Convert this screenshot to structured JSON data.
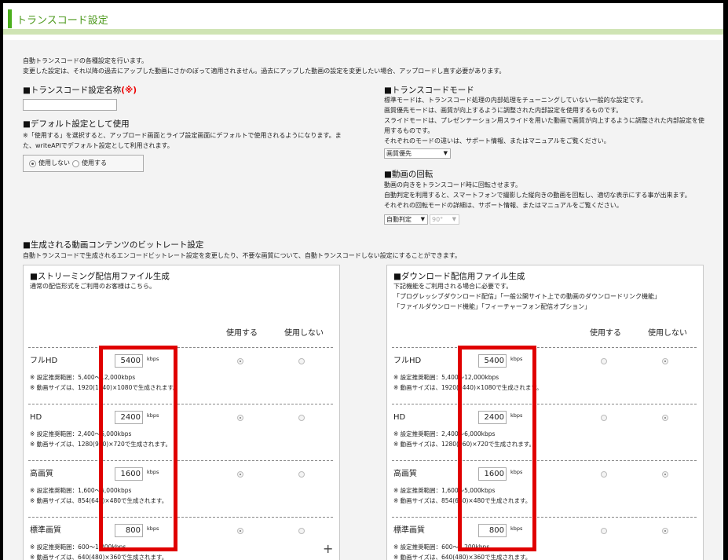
{
  "header": {
    "title": "トランスコード設定"
  },
  "intro": {
    "line1": "自動トランスコードの各種設定を行います。",
    "line2": "変更した設定は、それ以降の過去にアップした動画にさかのぼって適用されません。過去にアップした動画の設定を変更したい場合、アップロードし直す必要があります。"
  },
  "name_setting": {
    "label": "■トランスコード設定名称",
    "required": "(※)",
    "value": ""
  },
  "default_setting": {
    "label": "■デフォルト設定として使用",
    "desc1": "※「使用する」を選択すると、アップロード画面とライブ設定画面にデフォルトで使用されるようになります。ま",
    "desc2": "た、writeAPIでデフォルト設定として利用されます。",
    "opt_no": "使用しない",
    "opt_yes": "使用する",
    "selected": "no"
  },
  "mode": {
    "label": "■トランスコードモード",
    "desc1": "標準モードは、トランスコード処理の内部処理をチューニングしていない一般的な設定です。",
    "desc2": "画質優先モードは、画質が向上するように調整された内部設定を使用するものです。",
    "desc3": "スライドモードは、プレゼンテーション用スライドを用いた動画で画質が向上するように調整された内部設定を使",
    "desc4": "用するものです。",
    "desc5": "それぞれのモードの違いは、サポート情報、またはマニュアルをご覧ください。",
    "selected": "画質優先"
  },
  "rotation": {
    "label": "■動画の回転",
    "desc1": "動画の向きをトランスコード時に回転させます。",
    "desc2": "自動判定を利用すると、スマートフォンで撮影した縦向きの動画を回転し、適切な表示にする事が出来ます。",
    "desc3": "それぞれの回転モードの詳細は、サポート情報、またはマニュアルをご覧ください。",
    "mode_selected": "自動判定",
    "angle_selected": "90°"
  },
  "bitrate": {
    "label": "■生成される動画コンテンツのビットレート設定",
    "desc": "自動トランスコードで生成されるエンコードビットレート設定を変更したり、不要な画質について、自動トランスコードしない設定にすることができます。"
  },
  "col_use": "使用する",
  "col_nouse": "使用しない",
  "kbps": "kbps",
  "streaming": {
    "title": "■ストリーミング配信用ファイル生成",
    "desc": "通常の配信形式をご利用のお客様はこちら。",
    "rows": [
      {
        "name": "フルHD",
        "rate": "5400",
        "note1": "※ 設定推奨範囲：5,400～12,000kbps",
        "note2": "※ 動画サイズは、1920(1440)×1080で生成されます。",
        "use": true
      },
      {
        "name": "HD",
        "rate": "2400",
        "note1": "※ 設定推奨範囲：2,400～6,000kbps",
        "note2": "※ 動画サイズは、1280(960)×720で生成されます。",
        "use": true
      },
      {
        "name": "高画質",
        "rate": "1600",
        "note1": "※ 設定推奨範囲：1,600～5,000kbps",
        "note2": "※ 動画サイズは、854(640)×480で生成されます。",
        "use": true
      },
      {
        "name": "標準画質",
        "rate": "800",
        "note1": "※ 設定推奨範囲：600～1,200kbps",
        "note2": "※ 動画サイズは、640(480)×360で生成されます。",
        "use": true
      }
    ]
  },
  "download": {
    "title": "■ダウンロード配信用ファイル生成",
    "desc1": "下記機能をご利用される場合に必要です。",
    "desc2": "「プログレッシブダウンロード配信」「一般公開サイト上での動画のダウンロードリンク機能」",
    "desc3": "「ファイルダウンロード機能」「フィーチャーフォン配信オプション」",
    "rows": [
      {
        "name": "フルHD",
        "rate": "5400",
        "note1": "※ 設定推奨範囲：5,400～12,000kbps",
        "note2": "※ 動画サイズは、1920(1440)×1080で生成されます。",
        "use": false
      },
      {
        "name": "HD",
        "rate": "2400",
        "note1": "※ 設定推奨範囲：2,400～6,000kbps",
        "note2": "※ 動画サイズは、1280(960)×720で生成されます。",
        "use": false
      },
      {
        "name": "高画質",
        "rate": "1600",
        "note1": "※ 設定推奨範囲：1,600～5,000kbps",
        "note2": "※ 動画サイズは、854(640)×480で生成されます。",
        "use": false
      },
      {
        "name": "標準画質",
        "rate": "800",
        "note1": "※ 設定推奨範囲：600～1,200kbps",
        "note2": "※ 動画サイズは、640(480)×360で生成されます。",
        "use": false
      }
    ]
  },
  "colors": {
    "accent": "#4caf1e",
    "header_band": "#cfe4b4",
    "highlight": "#e00000"
  }
}
